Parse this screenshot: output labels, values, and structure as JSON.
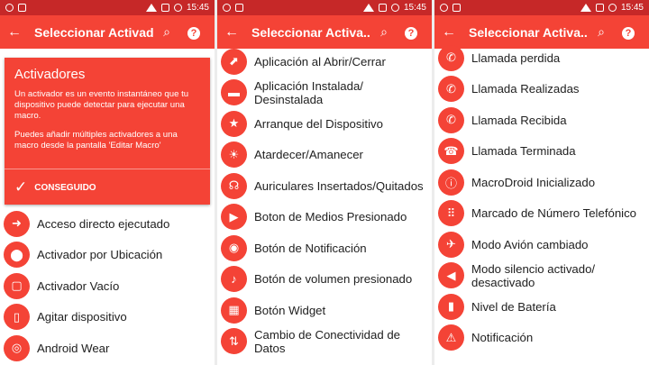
{
  "status": {
    "time": "15:45"
  },
  "title": "Seleccionar Activa...",
  "panel1": {
    "title": "Seleccionar Activadores",
    "card": {
      "heading": "Activadores",
      "p1": "Un activador es un evento instantáneo que tu dispositivo puede detectar para ejecutar una macro.",
      "p2": "Puedes añadir múltiples activadores a una macro desde la pantalla 'Editar Macro'",
      "button": "CONSEGUIDO"
    },
    "items": [
      {
        "label": "Acceso directo ejecutado",
        "icon": "arrow-right-icon",
        "glyph": "➜"
      },
      {
        "label": "Activador por Ubicación",
        "icon": "location-pin-icon",
        "glyph": "⬤"
      },
      {
        "label": "Activador Vacío",
        "icon": "empty-square-icon",
        "glyph": "▢"
      },
      {
        "label": "Agitar dispositivo",
        "icon": "shake-phone-icon",
        "glyph": "▯"
      },
      {
        "label": "Android Wear",
        "icon": "watch-icon",
        "glyph": "◎"
      }
    ]
  },
  "panel2": {
    "items": [
      {
        "label": "Aplicación al Abrir/Cerrar",
        "icon": "open-app-icon",
        "glyph": "⬈"
      },
      {
        "label": "Aplicación Instalada/\nDesinstalada",
        "icon": "install-icon",
        "glyph": "▬"
      },
      {
        "label": "Arranque del Dispositivo",
        "icon": "star-icon",
        "glyph": "★"
      },
      {
        "label": "Atardecer/Amanecer",
        "icon": "sun-icon",
        "glyph": "☀"
      },
      {
        "label": "Auriculares Insertados/Quitados",
        "icon": "headphones-icon",
        "glyph": "☊"
      },
      {
        "label": "Boton de Medios Presionado",
        "icon": "play-icon",
        "glyph": "▶"
      },
      {
        "label": "Botón de Notificación",
        "icon": "notification-button-icon",
        "glyph": "◉"
      },
      {
        "label": "Botón de volumen presionado",
        "icon": "volume-icon",
        "glyph": "♪"
      },
      {
        "label": "Botón Widget",
        "icon": "widget-icon",
        "glyph": "▦"
      },
      {
        "label": "Cambio de Conectividad de\nDatos",
        "icon": "connectivity-icon",
        "glyph": "⇅"
      }
    ]
  },
  "panel3": {
    "items": [
      {
        "label": "Llamada perdida",
        "icon": "missed-call-icon",
        "glyph": "✆"
      },
      {
        "label": "Llamada Realizadas",
        "icon": "outgoing-call-icon",
        "glyph": "✆"
      },
      {
        "label": "Llamada Recibida",
        "icon": "incoming-call-icon",
        "glyph": "✆"
      },
      {
        "label": "Llamada Terminada",
        "icon": "call-end-icon",
        "glyph": "☎"
      },
      {
        "label": "MacroDroid Inicializado",
        "icon": "info-icon",
        "glyph": "ⓘ"
      },
      {
        "label": "Marcado de Número Telefónico",
        "icon": "dialpad-icon",
        "glyph": "⠿"
      },
      {
        "label": "Modo Avión cambiado",
        "icon": "airplane-icon",
        "glyph": "✈"
      },
      {
        "label": "Modo silencio activado/\ndesactivado",
        "icon": "mute-icon",
        "glyph": "◀"
      },
      {
        "label": "Nivel de Batería",
        "icon": "battery-icon",
        "glyph": "▮"
      },
      {
        "label": "Notificación",
        "icon": "warning-icon",
        "glyph": "⚠"
      }
    ]
  },
  "colors": {
    "primary": "#f44336",
    "status": "#c62828"
  }
}
